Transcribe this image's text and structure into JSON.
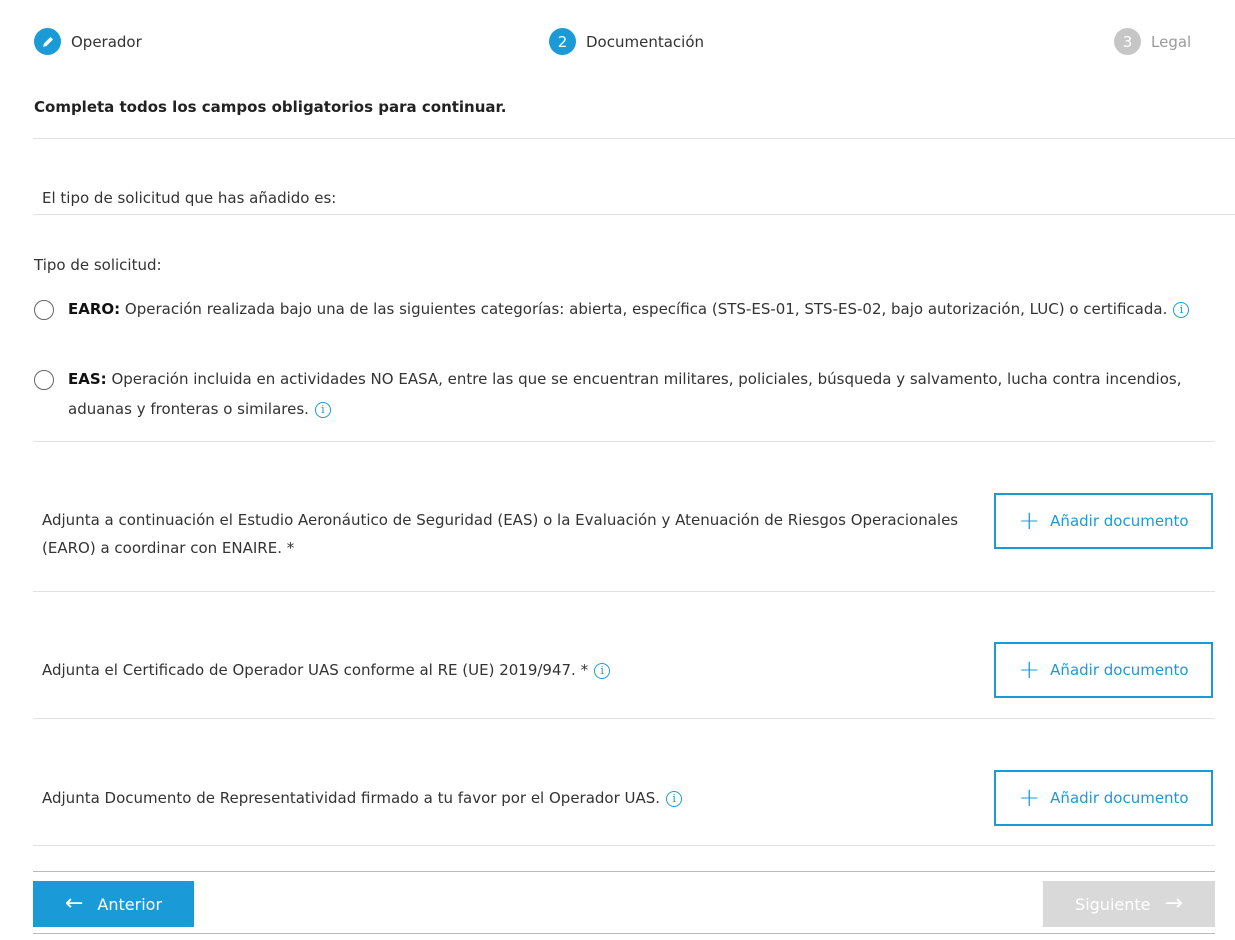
{
  "stepper": {
    "steps": [
      {
        "number": "",
        "label": "Operador",
        "state": "completed",
        "icon": "pencil-icon"
      },
      {
        "number": "2",
        "label": "Documentación",
        "state": "active"
      },
      {
        "number": "3",
        "label": "Legal",
        "state": "inactive"
      }
    ]
  },
  "form": {
    "instructions": "Completa todos los campos obligatorios para continuar.",
    "intro": "El tipo de solicitud que has añadido es:",
    "type_label": "Tipo de solicitud:",
    "options": [
      {
        "title": "EARO:",
        "text": " Operación realizada bajo una de las siguientes categorías: abierta, específica (STS-ES-01, STS-ES-02, bajo autorización, LUC) o certificada.",
        "selected": false
      },
      {
        "title": "EAS:",
        "text": " Operación incluida en actividades NO EASA, entre las que se encuentran militares, policiales, búsqueda y salvamento, lucha contra incendios, aduanas y fronteras o similares.",
        "selected": false
      }
    ],
    "documents": [
      {
        "text": "Adjunta a continuación el Estudio Aeronáutico de Seguridad (EAS) o la Evaluación y Atenuación de Riesgos Operacionales (EARO) a coordinar con ENAIRE. *",
        "button": "Añadir documento"
      },
      {
        "text": "Adjunta el Certificado de Operador UAS conforme al RE (UE) 2019/947. *",
        "button": "Añadir documento"
      },
      {
        "text": "Adjunta Documento de Representatividad firmado a tu favor por el Operador UAS.",
        "button": "Añadir documento"
      }
    ]
  },
  "navigation": {
    "prev_label": "Anterior",
    "next_label": "Siguiente",
    "next_enabled": false
  },
  "colors": {
    "accent": "#1a9bd7",
    "disabled": "#d9d9d9",
    "inactive_step": "#c6c6c6"
  }
}
